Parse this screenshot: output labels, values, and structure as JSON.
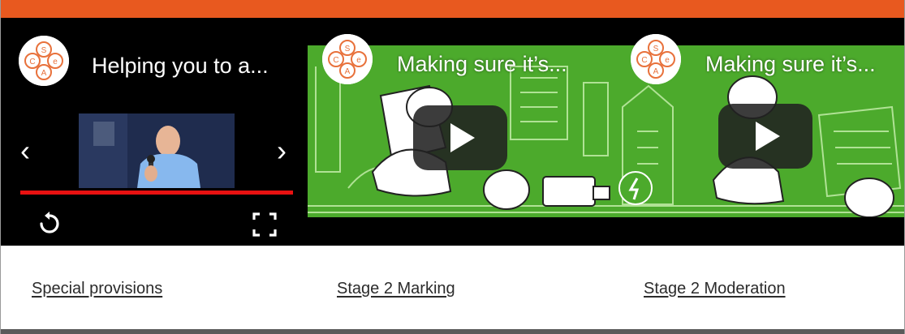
{
  "header": {
    "accent_color": "#e8591f"
  },
  "videos": [
    {
      "title": "Helping you to a...",
      "logo": {
        "icon": "csa-logo-icon",
        "letters": [
          "S",
          "C",
          "e",
          "A"
        ]
      },
      "player": {
        "prev_icon": "chevron-left-icon",
        "next_icon": "chevron-right-icon",
        "prev_glyph": "‹",
        "next_glyph": "›",
        "replay_icon": "replay-icon",
        "fullscreen_icon": "fullscreen-icon",
        "progress_fraction": 1.0,
        "progress_color": "#e81111"
      }
    },
    {
      "title": "Making sure it’s...",
      "logo": {
        "icon": "csa-logo-icon",
        "letters": [
          "S",
          "C",
          "e",
          "A"
        ]
      },
      "play_icon": "play-icon"
    },
    {
      "title": "Making sure it’s...",
      "logo": {
        "icon": "csa-logo-icon",
        "letters": [
          "S",
          "C",
          "e",
          "A"
        ]
      },
      "play_icon": "play-icon"
    }
  ],
  "links": [
    {
      "label": "Special provisions"
    },
    {
      "label": "Stage 2 Marking"
    },
    {
      "label": "Stage 2 Moderation"
    }
  ],
  "colors": {
    "thumbnail_green": "#4caa2c",
    "play_button": "#212121"
  }
}
